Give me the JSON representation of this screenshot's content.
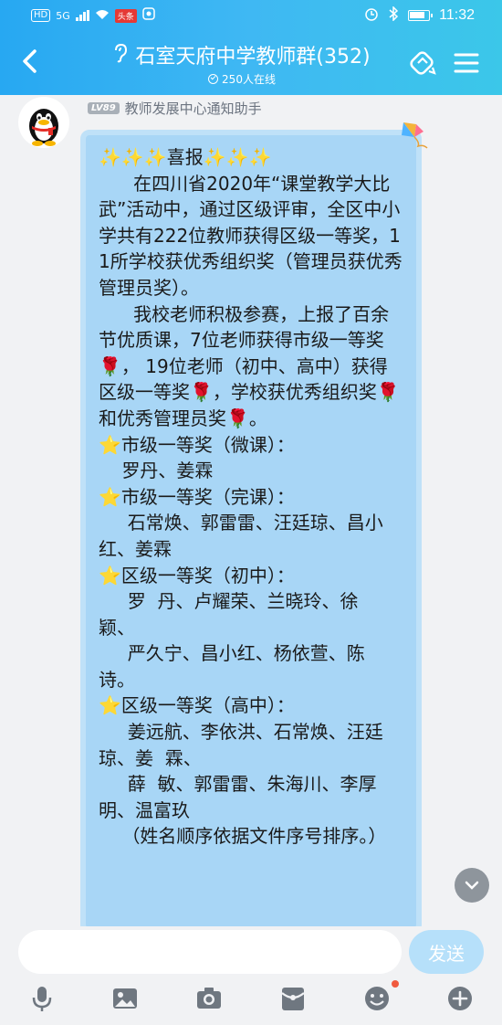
{
  "status_bar": {
    "hd": "HD",
    "signal": "5G",
    "app_badge": "头条",
    "time": "11:32"
  },
  "header": {
    "title": "石室天府中学教师群(352)",
    "online": "250人在线"
  },
  "message": {
    "level": "LV89",
    "sender": "教师发展中心通知助手",
    "text": "✨✨✨喜报✨✨✨\n      在四川省2020年“课堂教学大比武”活动中，通过区级评审，全区中小学共有222位教师获得区级一等奖，11所学校获优秀组织奖（管理员获优秀管理员奖）。\n      我校老师积极参赛，上报了百余节优质课，7位老师获得市级一等奖🌹， 19位老师（初中、高中）获得区级一等奖🌹，学校获优秀组织奖🌹和优秀管理员奖🌹。\n⭐市级一等奖（微课）：\n    罗丹、姜霖\n⭐市级一等奖（完课）：\n     石常焕、郭雷雷、汪廷琼、昌小红、姜霖\n⭐区级一等奖（初中）：\n     罗  丹、卢耀荣、兰晓玲、徐  颖、\n     严久宁、昌小红、杨依萱、陈  诗。\n⭐区级一等奖（高中）：\n     姜远航、李依洪、石常焕、汪廷琼、姜  霖、\n     薛  敏、郭雷雷、朱海川、李厚明、温富玖\n    （姓名顺序依据文件序号排序。）"
  },
  "input": {
    "placeholder": "",
    "send_label": "发送"
  },
  "toolbar": {
    "items": [
      "microphone-icon",
      "image-icon",
      "camera-icon",
      "red-packet-icon",
      "emoji-icon",
      "plus-icon"
    ]
  },
  "colors": {
    "header_start": "#27a8f2",
    "header_end": "#3bc7e9",
    "bubble": "#a8d6f6",
    "send_button": "#b6e0fa"
  }
}
